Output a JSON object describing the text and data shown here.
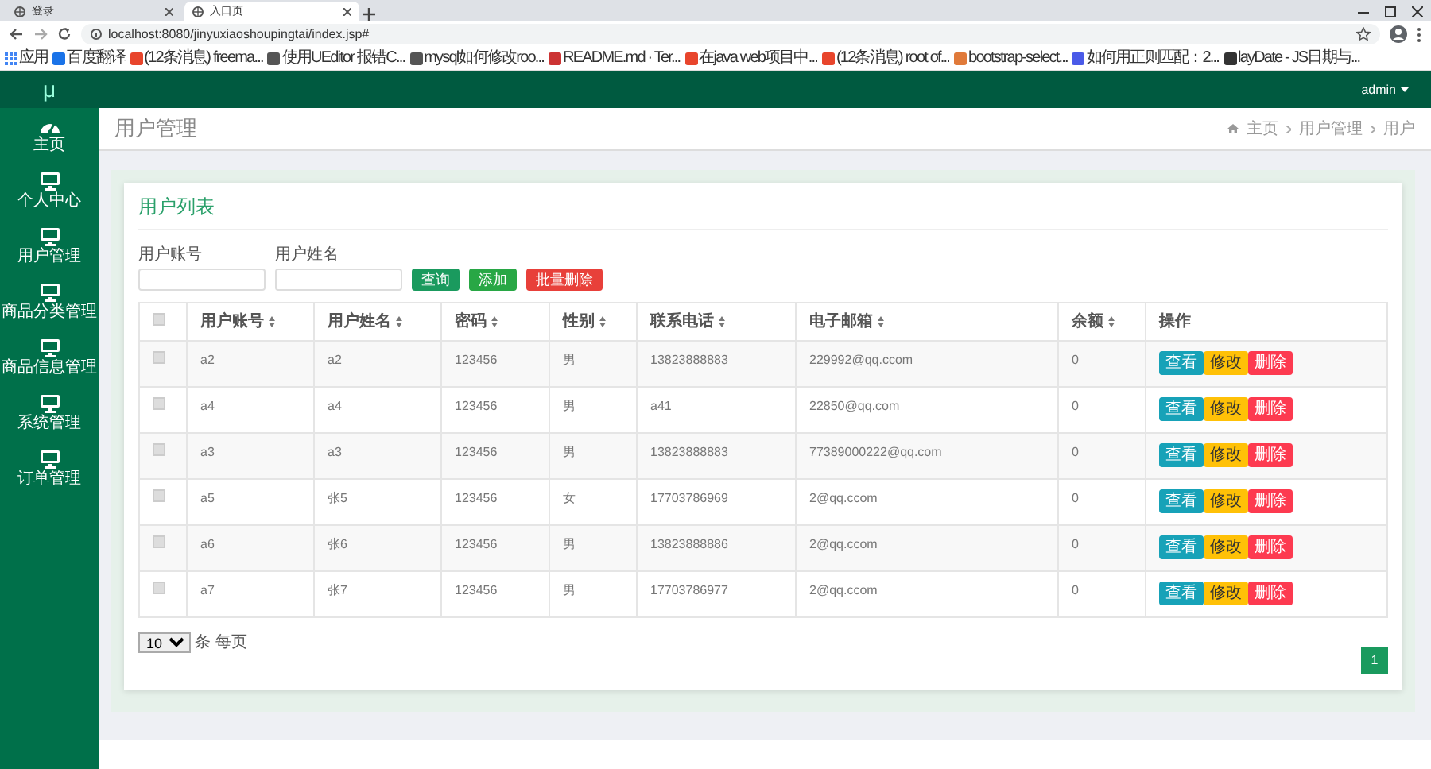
{
  "browser": {
    "tabs": [
      {
        "title": "登录",
        "selected": false
      },
      {
        "title": "入口页",
        "selected": true
      }
    ],
    "address": "localhost:8080/jinyuxiaoshoupingtai/index.jsp#",
    "bookmarks": [
      "应用",
      "百度翻译",
      "(12条消息) freema...",
      "使用UEditor 报错C...",
      "mysql如何修改roo...",
      "README.md · Ter...",
      "在java web项目中...",
      "(12条消息) root of...",
      "bootstrap-select...",
      "如何用正则匹配：2...",
      "layDate - JS日期与..."
    ]
  },
  "app": {
    "logo": "μ",
    "user": "admin",
    "sidebar": {
      "items": [
        {
          "label": "主页",
          "kind": "dashboard"
        },
        {
          "label": "个人中心",
          "kind": "monitor"
        },
        {
          "label": "用户管理",
          "kind": "monitor"
        },
        {
          "label": "商品分类管理",
          "kind": "monitor"
        },
        {
          "label": "商品信息管理",
          "kind": "monitor"
        },
        {
          "label": "系统管理",
          "kind": "monitor"
        },
        {
          "label": "订单管理",
          "kind": "monitor"
        }
      ]
    },
    "page_title": "用户管理",
    "breadcrumb": [
      "主页",
      "用户管理",
      "用户"
    ],
    "card_title": "用户列表",
    "search": {
      "fields": [
        {
          "label": "用户账号"
        },
        {
          "label": "用户姓名"
        }
      ],
      "buttons": [
        {
          "label": "查询",
          "kind": "search"
        },
        {
          "label": "添加",
          "kind": "add"
        },
        {
          "label": "批量删除",
          "kind": "delete"
        }
      ]
    },
    "table": {
      "header_checked": false,
      "columns": [
        {
          "label": "用户账号",
          "sortable": true
        },
        {
          "label": "用户姓名",
          "sortable": true
        },
        {
          "label": "密码",
          "sortable": true
        },
        {
          "label": "性别",
          "sortable": true
        },
        {
          "label": "联系电话",
          "sortable": true
        },
        {
          "label": "电子邮箱",
          "sortable": true
        },
        {
          "label": "余额",
          "sortable": true
        },
        {
          "label": "操作",
          "sortable": false
        }
      ],
      "rows": [
        {
          "checked": false,
          "cells": [
            "a2",
            "a2",
            "123456",
            "男",
            "13823888883",
            "229992@qq.ccom",
            "0"
          ],
          "actions": [
            {
              "label": "查看",
              "kind": "view"
            },
            {
              "label": "修改",
              "kind": "edit"
            },
            {
              "label": "删除",
              "kind": "delete"
            }
          ]
        },
        {
          "checked": false,
          "cells": [
            "a4",
            "a4",
            "123456",
            "男",
            "a41",
            "22850@qq.com",
            "0"
          ],
          "actions": [
            {
              "label": "查看",
              "kind": "view"
            },
            {
              "label": "修改",
              "kind": "edit"
            },
            {
              "label": "删除",
              "kind": "delete"
            }
          ]
        },
        {
          "checked": false,
          "cells": [
            "a3",
            "a3",
            "123456",
            "男",
            "13823888883",
            "77389000222@qq.com",
            "0"
          ],
          "actions": [
            {
              "label": "查看",
              "kind": "view"
            },
            {
              "label": "修改",
              "kind": "edit"
            },
            {
              "label": "删除",
              "kind": "delete"
            }
          ]
        },
        {
          "checked": false,
          "cells": [
            "a5",
            "张5",
            "123456",
            "女",
            "17703786969",
            "2@qq.ccom",
            "0"
          ],
          "actions": [
            {
              "label": "查看",
              "kind": "view"
            },
            {
              "label": "修改",
              "kind": "edit"
            },
            {
              "label": "删除",
              "kind": "delete"
            }
          ]
        },
        {
          "checked": false,
          "cells": [
            "a6",
            "张6",
            "123456",
            "男",
            "13823888886",
            "2@qq.ccom",
            "0"
          ],
          "actions": [
            {
              "label": "查看",
              "kind": "view"
            },
            {
              "label": "修改",
              "kind": "edit"
            },
            {
              "label": "删除",
              "kind": "delete"
            }
          ]
        },
        {
          "checked": false,
          "cells": [
            "a7",
            "张7",
            "123456",
            "男",
            "17703786977",
            "2@qq.ccom",
            "0"
          ],
          "actions": [
            {
              "label": "查看",
              "kind": "view"
            },
            {
              "label": "修改",
              "kind": "edit"
            },
            {
              "label": "删除",
              "kind": "delete"
            }
          ]
        }
      ]
    },
    "page_size": "10",
    "page_size_label": "条 每页",
    "pages": [
      {
        "label": "1",
        "selected": true
      }
    ]
  }
}
